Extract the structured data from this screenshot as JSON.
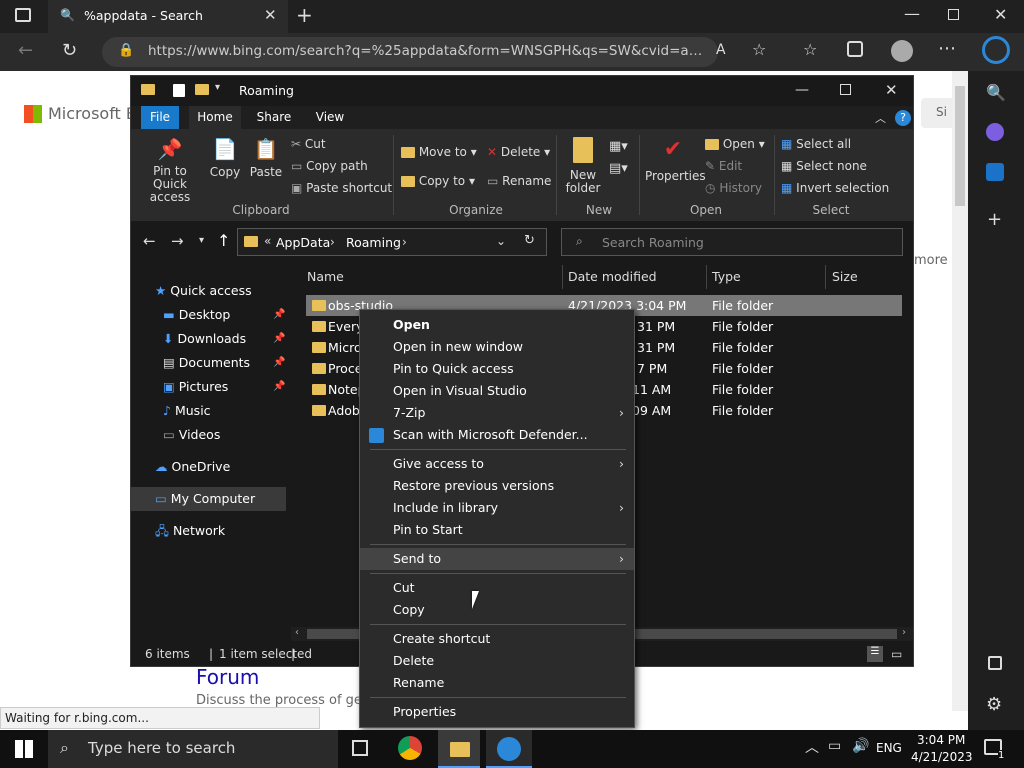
{
  "browser": {
    "tab_title": "%appdata - Search",
    "url": "https://www.bing.com/search?q=%25appdata&form=WNSGPH&qs=SW&cvid=a7e33ad...",
    "status": "Waiting for r.bing.com...",
    "page": {
      "logo": "Microsoft Bin",
      "forum_title": "Forum",
      "forum_desc": "Discuss the process of get",
      "more": "more",
      "sign_in": "Si"
    }
  },
  "explorer": {
    "title": "Roaming",
    "tabs": [
      "File",
      "Home",
      "Share",
      "View"
    ],
    "clipboard": {
      "pin": "Pin to Quick access",
      "copy": "Copy",
      "paste": "Paste",
      "cut": "Cut",
      "copy_path": "Copy path",
      "paste_shortcut": "Paste shortcut",
      "group": "Clipboard"
    },
    "organize": {
      "move_to": "Move to",
      "copy_to": "Copy to",
      "delete": "Delete",
      "rename": "Rename",
      "group": "Organize"
    },
    "new": {
      "new_folder": "New folder",
      "group": "New"
    },
    "open": {
      "properties": "Properties",
      "open": "Open",
      "edit": "Edit",
      "history": "History",
      "group": "Open"
    },
    "select": {
      "select_all": "Select all",
      "select_none": "Select none",
      "invert": "Invert selection",
      "group": "Select"
    },
    "breadcrumb": {
      "parent": "AppData",
      "current": "Roaming",
      "prefix": "«"
    },
    "search_placeholder": "Search Roaming",
    "columns": {
      "name": "Name",
      "date": "Date modified",
      "type": "Type",
      "size": "Size"
    },
    "nav": [
      {
        "label": "Quick access"
      },
      {
        "label": "Desktop"
      },
      {
        "label": "Downloads"
      },
      {
        "label": "Documents"
      },
      {
        "label": "Pictures"
      },
      {
        "label": "Music"
      },
      {
        "label": "Videos"
      },
      {
        "label": "OneDrive"
      },
      {
        "label": "My Computer"
      },
      {
        "label": "Network"
      }
    ],
    "files": [
      {
        "name": "obs-studio",
        "date": "4/21/2023 3:04 PM",
        "type": "File folder"
      },
      {
        "name": "Everyt",
        "date": "31 PM",
        "type": "File folder"
      },
      {
        "name": "Micro",
        "date": "31 PM",
        "type": "File folder"
      },
      {
        "name": "Proce",
        "date": "7 PM",
        "type": "File folder"
      },
      {
        "name": "Notep",
        "date": "11 AM",
        "type": "File folder"
      },
      {
        "name": "Adob",
        "date": "09 AM",
        "type": "File folder"
      }
    ],
    "status": {
      "items": "6 items",
      "selected": "1 item selected"
    }
  },
  "context_menu": [
    "Open",
    "Open in new window",
    "Pin to Quick access",
    "Open in Visual Studio",
    "7-Zip",
    "Scan with Microsoft Defender...",
    "Give access to",
    "Restore previous versions",
    "Include in library",
    "Pin to Start",
    "Send to",
    "Cut",
    "Copy",
    "Create shortcut",
    "Delete",
    "Rename",
    "Properties"
  ],
  "taskbar": {
    "search_placeholder": "Type here to search",
    "time": "3:04 PM",
    "date": "4/21/2023",
    "lang": "ENG",
    "notif_count": "1"
  }
}
